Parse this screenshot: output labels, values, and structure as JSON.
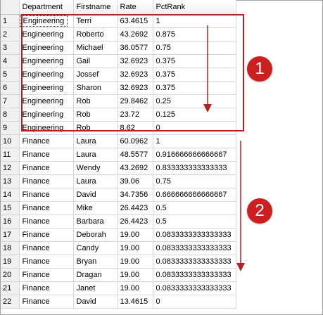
{
  "grid": {
    "columns": [
      "",
      "Department",
      "Firstname",
      "Rate",
      "PctRank"
    ],
    "rows": [
      [
        "1",
        "Engineering",
        "Terri",
        "63.4615",
        "1"
      ],
      [
        "2",
        "Engineering",
        "Roberto",
        "43.2692",
        "0.875"
      ],
      [
        "3",
        "Engineering",
        "Michael",
        "36.0577",
        "0.75"
      ],
      [
        "4",
        "Engineering",
        "Gail",
        "32.6923",
        "0.375"
      ],
      [
        "5",
        "Engineering",
        "Jossef",
        "32.6923",
        "0.375"
      ],
      [
        "6",
        "Engineering",
        "Sharon",
        "32.6923",
        "0.375"
      ],
      [
        "7",
        "Engineering",
        "Rob",
        "29.8462",
        "0.25"
      ],
      [
        "8",
        "Engineering",
        "Rob",
        "23.72",
        "0.125"
      ],
      [
        "9",
        "Engineering",
        "Rob",
        "8.62",
        "0"
      ],
      [
        "10",
        "Finance",
        "Laura",
        "60.0962",
        "1"
      ],
      [
        "11",
        "Finance",
        "Laura",
        "48.5577",
        "0.916666666666667"
      ],
      [
        "12",
        "Finance",
        "Wendy",
        "43.2692",
        "0.833333333333333"
      ],
      [
        "13",
        "Finance",
        "Laura",
        "39.06",
        "0.75"
      ],
      [
        "14",
        "Finance",
        "David",
        "34.7356",
        "0.666666666666667"
      ],
      [
        "15",
        "Finance",
        "Mike",
        "26.4423",
        "0.5"
      ],
      [
        "16",
        "Finance",
        "Barbara",
        "26.4423",
        "0.5"
      ],
      [
        "17",
        "Finance",
        "Deborah",
        "19.00",
        "0.0833333333333333"
      ],
      [
        "18",
        "Finance",
        "Candy",
        "19.00",
        "0.0833333333333333"
      ],
      [
        "19",
        "Finance",
        "Bryan",
        "19.00",
        "0.0833333333333333"
      ],
      [
        "20",
        "Finance",
        "Dragan",
        "19.00",
        "0.0833333333333333"
      ],
      [
        "21",
        "Finance",
        "Janet",
        "19.00",
        "0.0833333333333333"
      ],
      [
        "22",
        "Finance",
        "David",
        "13.4615",
        "0"
      ]
    ]
  },
  "annotations": {
    "marker_1": "1",
    "marker_2": "2",
    "accent_color": "#cc1f1f",
    "box_color": "#b22222"
  }
}
